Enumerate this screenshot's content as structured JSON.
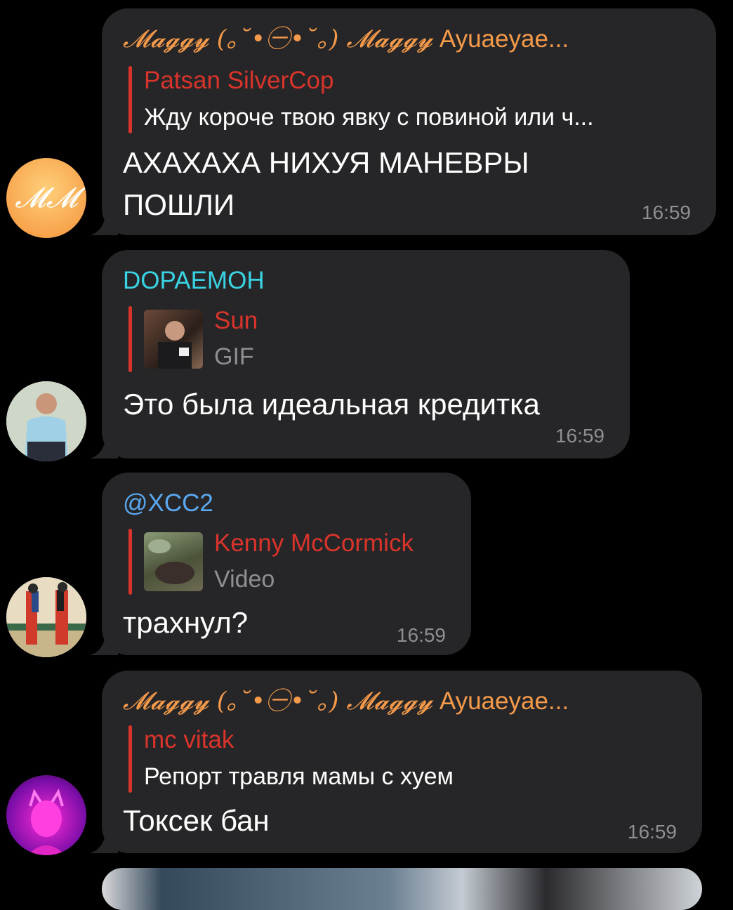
{
  "colors": {
    "bubble": "#262628",
    "reply_accent": "#d9342b",
    "name_orange": "#f59a4a",
    "name_cyan": "#3ad3e3",
    "name_blue": "#5aa8f0",
    "time": "#8e8e93"
  },
  "messages": [
    {
      "sender_fancy": "𝓜𝓪𝓰𝓰𝔂 (｡˘•㊀•˘｡) 𝓜𝓪𝓰𝓰𝔂",
      "sender_suffix": " Ayuaeyae...",
      "reply_author": "Patsan SilverCop",
      "reply_text": "Жду короче твою явку с повиной или ч...",
      "text": "АХАХАХА НИХУЯ МАНЕВРЫ ПОШЛИ",
      "time": "16:59",
      "avatar_initials": "𝓜𝓜"
    },
    {
      "sender": "DOPAEMOH",
      "reply_author": "Sun",
      "reply_type": "GIF",
      "text": "Это была идеальная кредитка",
      "time": "16:59"
    },
    {
      "sender": "@XCC2",
      "reply_author": "Kenny McCormick",
      "reply_type": "Video",
      "text": "трахнул?",
      "time": "16:59"
    },
    {
      "sender_fancy": "𝓜𝓪𝓰𝓰𝔂 (｡˘•㊀•˘｡) 𝓜𝓪𝓰𝓰𝔂",
      "sender_suffix": " Ayuaeyae...",
      "reply_author": "mc vitak",
      "reply_text": "Репорт травля мамы с хуем",
      "text": "Токсек бан",
      "time": "16:59"
    }
  ]
}
